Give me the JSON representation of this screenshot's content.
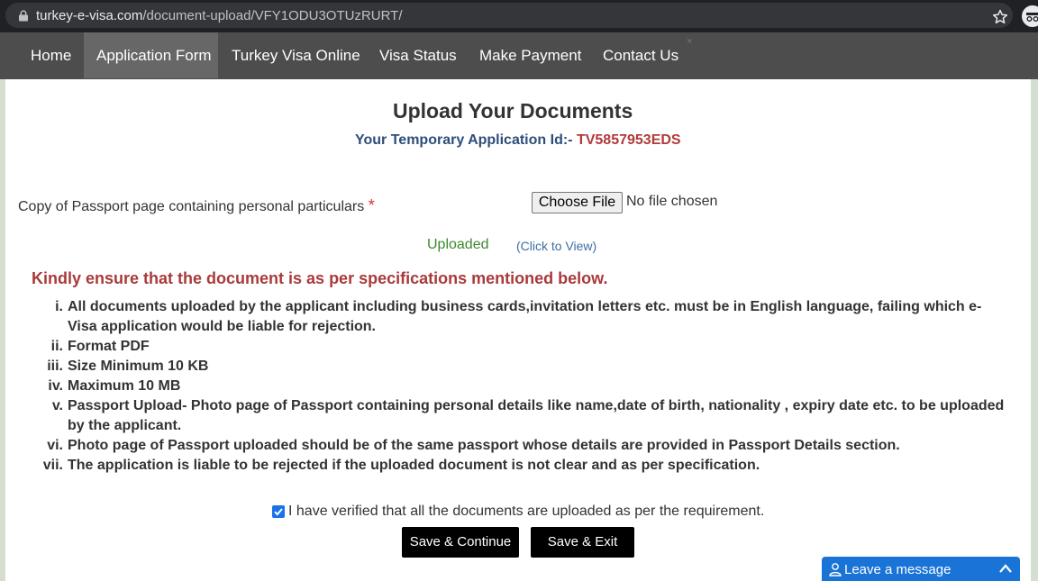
{
  "browser": {
    "url_host": "turkey-e-visa.com",
    "url_path": "/document-upload/VFY1ODU3OTUzRURT/"
  },
  "nav": {
    "items": [
      "Home",
      "Application Form",
      "Turkey Visa Online",
      "Visa Status",
      "Make Payment",
      "Contact Us"
    ],
    "active": "Application Form",
    "close_glyph": "×"
  },
  "page": {
    "title": "Upload Your Documents",
    "appid_label": "Your Temporary Application Id:-",
    "appid_value": "TV5857953EDS"
  },
  "upload": {
    "label": "Copy of Passport page containing personal particulars",
    "required_mark": "*",
    "choose_file": "Choose File",
    "file_status": "No file chosen",
    "uploaded": "Uploaded",
    "view_link": "(Click to View)"
  },
  "specs": {
    "warning": "Kindly ensure that the document is as per specifications mentioned below.",
    "items": [
      {
        "num": "i.",
        "lines": [
          "All documents uploaded by the applicant including business cards,invitation letters etc. must be in English language, failing which e-",
          "Visa application would be liable for rejection."
        ]
      },
      {
        "num": "ii.",
        "lines": [
          "Format PDF"
        ]
      },
      {
        "num": "iii.",
        "lines": [
          "Size Minimum 10 KB"
        ]
      },
      {
        "num": "iv.",
        "lines": [
          "Maximum 10 MB"
        ]
      },
      {
        "num": "v.",
        "lines": [
          "Passport Upload- Photo page of Passport containing personal details like name,date of birth, nationality , expiry date etc. to be uploaded",
          "by the applicant."
        ]
      },
      {
        "num": "vi.",
        "lines": [
          "Photo page of Passport uploaded should be of the same passport whose details are provided in Passport Details section."
        ]
      },
      {
        "num": "vii.",
        "lines": [
          "The application is liable to be rejected if the uploaded document is not clear and as per specification."
        ]
      }
    ]
  },
  "verify": {
    "text": "I have verified that all the documents are uploaded as per the requirement.",
    "checked": true
  },
  "buttons": {
    "save_continue": "Save & Continue",
    "save_exit": "Save & Exit"
  },
  "chat": {
    "label": "Leave a message"
  }
}
